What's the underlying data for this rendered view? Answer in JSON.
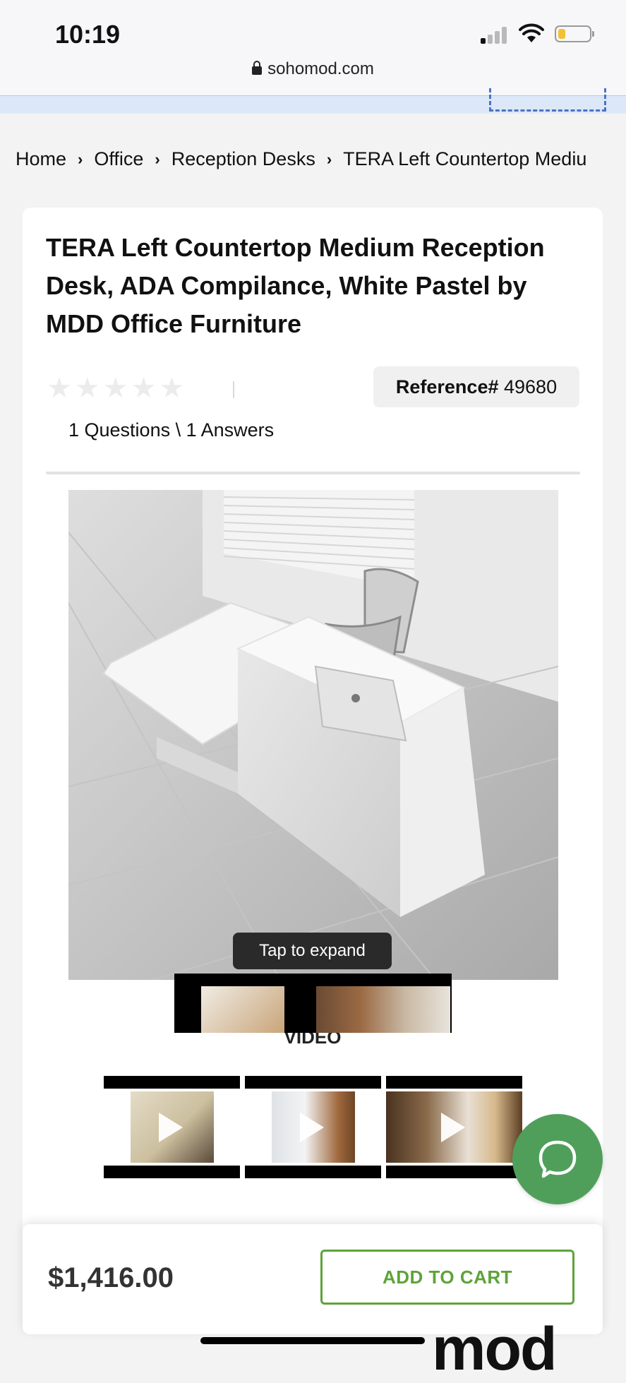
{
  "status_bar": {
    "time": "10:19"
  },
  "browser": {
    "url": "sohomod.com"
  },
  "breadcrumb": [
    "Home",
    "Office",
    "Reception Desks",
    "TERA Left Countertop Mediu"
  ],
  "product": {
    "title": "TERA Left Countertop Medium Reception Desk, ADA Compilance, White Pastel by MDD Office Furniture",
    "rating_stars": 0,
    "reference_label": "Reference#",
    "reference_value": "49680",
    "qa_text": "1 Questions \\ 1 Answers",
    "image_expand_label": "Tap to expand",
    "video_heading": "VIDEO",
    "video_count_visible": 5
  },
  "cart_bar": {
    "price": "$1,416.00",
    "add_to_cart_label": "ADD TO CART"
  },
  "colors": {
    "accent_green": "#5ea33a",
    "chat_green": "#4f9f5b",
    "badge_bg": "#f0f0f0"
  },
  "icons": [
    "lock-icon",
    "chevron-right-icon",
    "star-icon",
    "play-icon",
    "chat-icon",
    "wifi-icon",
    "battery-icon",
    "signal-icon"
  ]
}
